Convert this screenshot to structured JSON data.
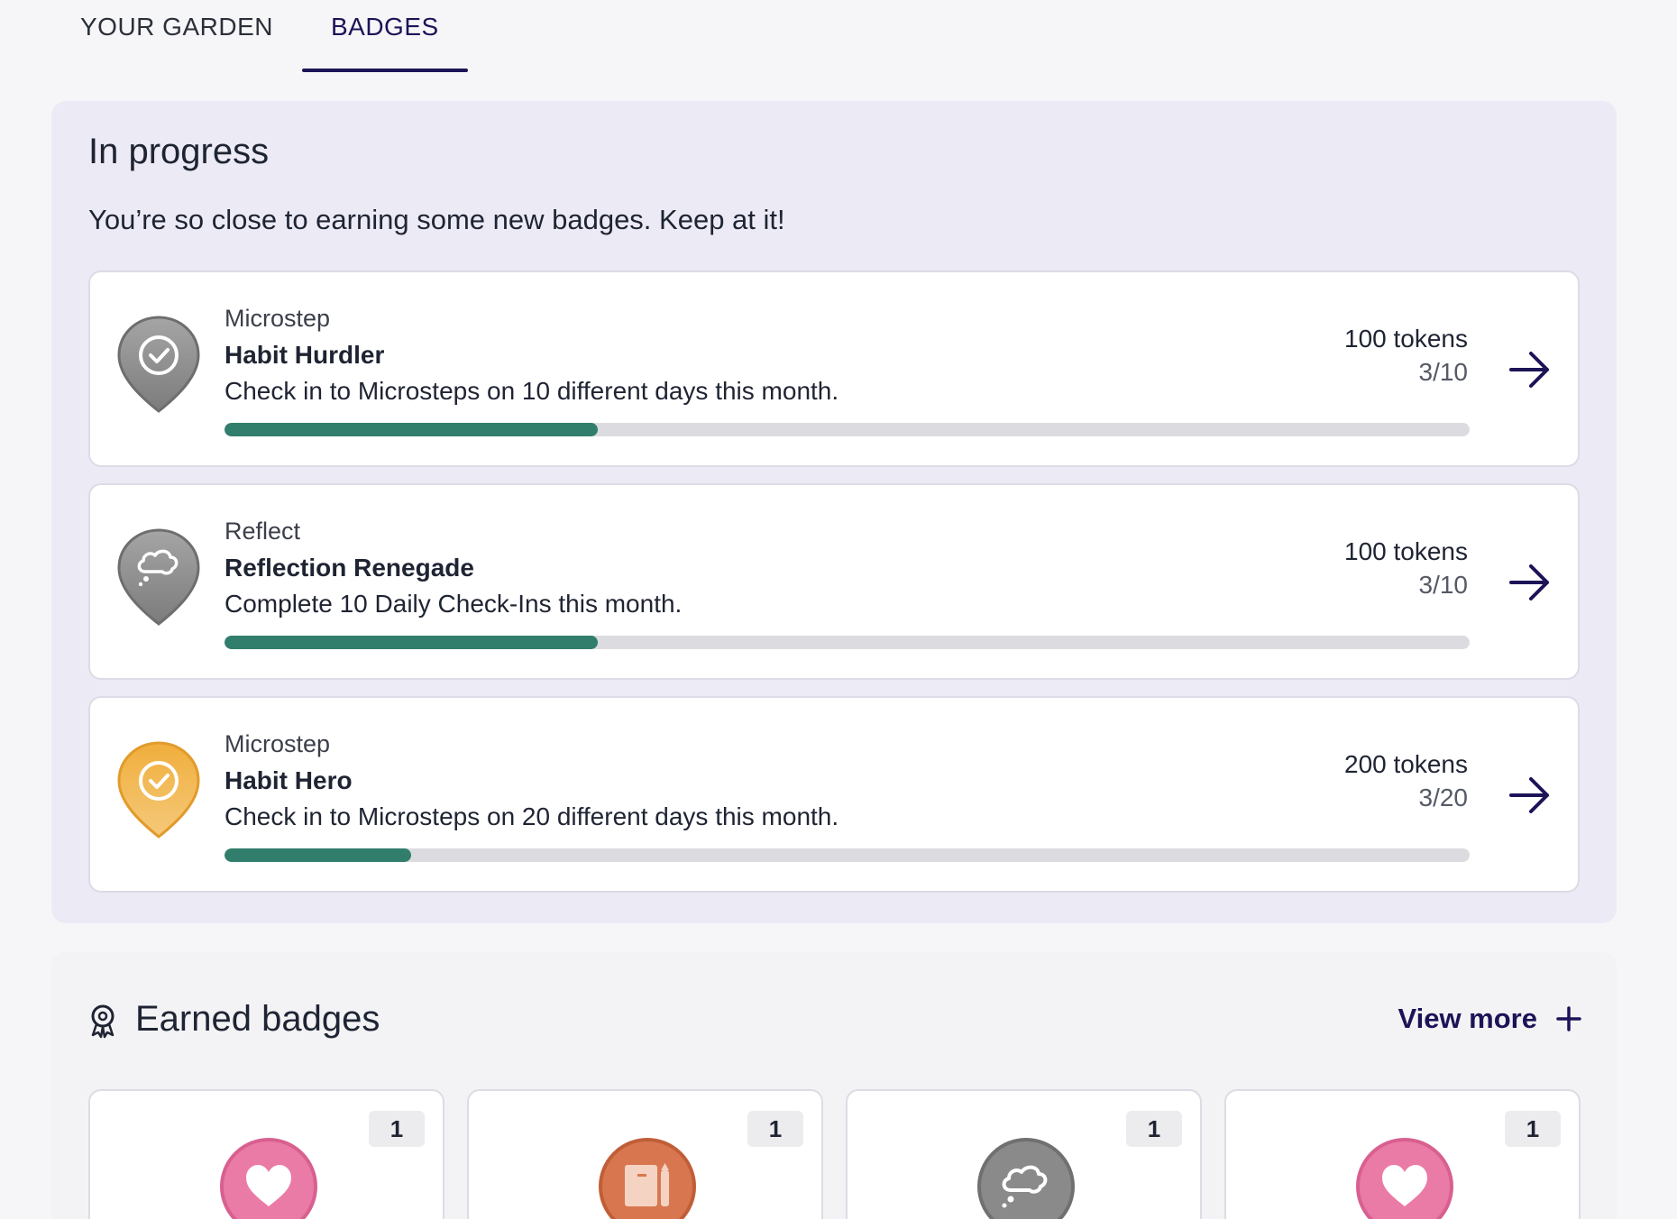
{
  "tabs": [
    {
      "label": "YOUR GARDEN",
      "active": false
    },
    {
      "label": "BADGES",
      "active": true
    }
  ],
  "in_progress": {
    "title": "In progress",
    "subtitle": "You’re so close to earning some new badges. Keep at it!",
    "items": [
      {
        "category": "Microstep",
        "name": "Habit Hurdler",
        "description": "Check in to Microsteps on 10 different days this month.",
        "tokens": "100 tokens",
        "progress_text": "3/10",
        "progress": 0.3,
        "badge_icon": "check-icon",
        "badge_color": "#8a8a8a"
      },
      {
        "category": "Reflect",
        "name": "Reflection Renegade",
        "description": "Complete 10 Daily Check-Ins this month.",
        "tokens": "100 tokens",
        "progress_text": "3/10",
        "progress": 0.3,
        "badge_icon": "thought-bubble-icon",
        "badge_color": "#8a8a8a"
      },
      {
        "category": "Microstep",
        "name": "Habit Hero",
        "description": "Check in to Microsteps on 20 different days this month.",
        "tokens": "200 tokens",
        "progress_text": "3/20",
        "progress": 0.15,
        "badge_icon": "check-icon",
        "badge_color": "#f0b143"
      }
    ]
  },
  "earned": {
    "title": "Earned badges",
    "view_more": "View more",
    "items": [
      {
        "count": "1",
        "badge_icon": "heart-icon",
        "badge_color": "#ea7aa6"
      },
      {
        "count": "1",
        "badge_icon": "journal-icon",
        "badge_color": "#d8774f"
      },
      {
        "count": "1",
        "badge_icon": "thought-bubble-icon",
        "badge_color": "#8a8a8a"
      },
      {
        "count": "1",
        "badge_icon": "heart-icon",
        "badge_color": "#ea7aa6"
      }
    ]
  },
  "colors": {
    "accent": "#1c1457",
    "progress_fill": "#317e6c",
    "progress_track": "#dcdce0",
    "section_bg": "#ecebf5"
  }
}
